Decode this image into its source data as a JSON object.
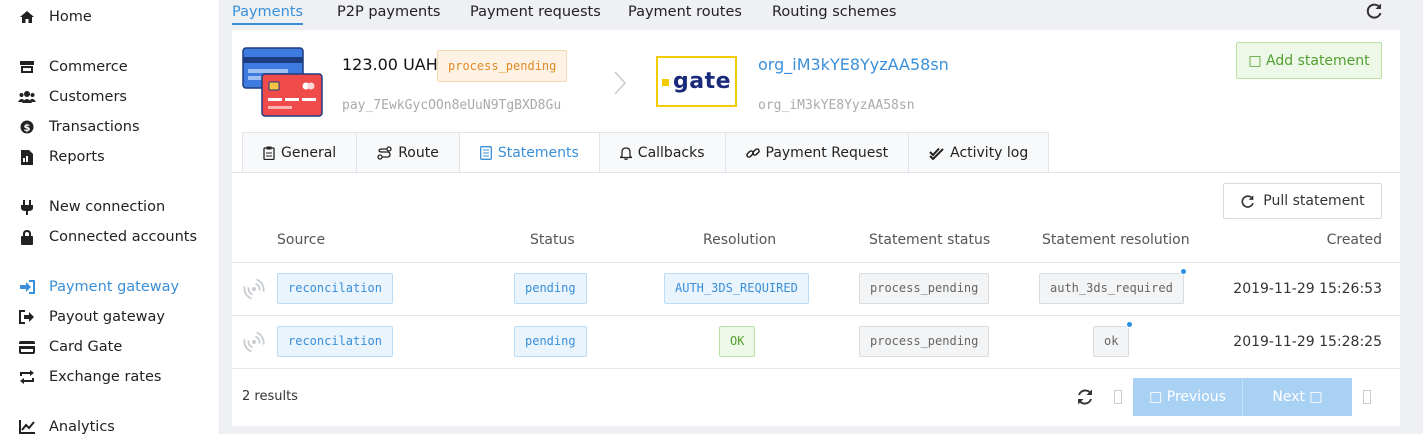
{
  "sidebar": {
    "items": [
      {
        "label": "Home",
        "icon": "home-icon"
      },
      {
        "label": "Commerce",
        "icon": "store-icon"
      },
      {
        "label": "Customers",
        "icon": "users-icon"
      },
      {
        "label": "Transactions",
        "icon": "dollar-icon"
      },
      {
        "label": "Reports",
        "icon": "file-icon"
      },
      {
        "label": "New connection",
        "icon": "plug-icon"
      },
      {
        "label": "Connected accounts",
        "icon": "lock-icon"
      },
      {
        "label": "Payment gateway",
        "icon": "sign-in-icon",
        "active": true
      },
      {
        "label": "Payout gateway",
        "icon": "sign-out-icon"
      },
      {
        "label": "Card Gate",
        "icon": "credit-card-icon"
      },
      {
        "label": "Exchange rates",
        "icon": "exchange-icon"
      },
      {
        "label": "Analytics",
        "icon": "chart-icon"
      }
    ]
  },
  "topnav": {
    "items": [
      "Payments",
      "P2P payments",
      "Payment requests",
      "Payment routes",
      "Routing schemes"
    ]
  },
  "payment": {
    "amount": "123.00 UAH",
    "status": "process_pending",
    "id": "pay_7EwkGycOOn8eUuN9TgBXD8Gu",
    "gate_logo_text": "gate",
    "org_name": "org_iM3kYE8YyzAA58sn",
    "org_id": "org_iM3kYE8YyzAA58sn",
    "add_statement_label": "□ Add statement"
  },
  "tabs": [
    {
      "label": "General",
      "icon": "clipboard-icon"
    },
    {
      "label": "Route",
      "icon": "route-icon"
    },
    {
      "label": "Statements",
      "icon": "list-icon",
      "active": true
    },
    {
      "label": "Callbacks",
      "icon": "bell-icon"
    },
    {
      "label": "Payment Request",
      "icon": "link-icon"
    },
    {
      "label": "Activity log",
      "icon": "check-double-icon"
    }
  ],
  "pull_statement_label": "Pull statement",
  "table": {
    "headers": [
      "Source",
      "Status",
      "Resolution",
      "Statement status",
      "Statement resolution",
      "Created"
    ],
    "rows": [
      {
        "source": "reconcilation",
        "status": "pending",
        "resolution": "AUTH_3DS_REQUIRED",
        "statement_status": "process_pending",
        "statement_resolution": "auth_3ds_required",
        "created": "2019-11-29 15:26:53"
      },
      {
        "source": "reconcilation",
        "status": "pending",
        "resolution": "OK",
        "statement_status": "process_pending",
        "statement_resolution": "ok",
        "created": "2019-11-29 15:28:25"
      }
    ]
  },
  "footer": {
    "results": "2 results",
    "previous_label": "□ Previous",
    "next_label": "Next □"
  },
  "colors": {
    "accent": "#3a8fd9",
    "pending_orange": "#e08b27",
    "success_green": "#52a030",
    "gate_yellow": "#f2cc00"
  }
}
